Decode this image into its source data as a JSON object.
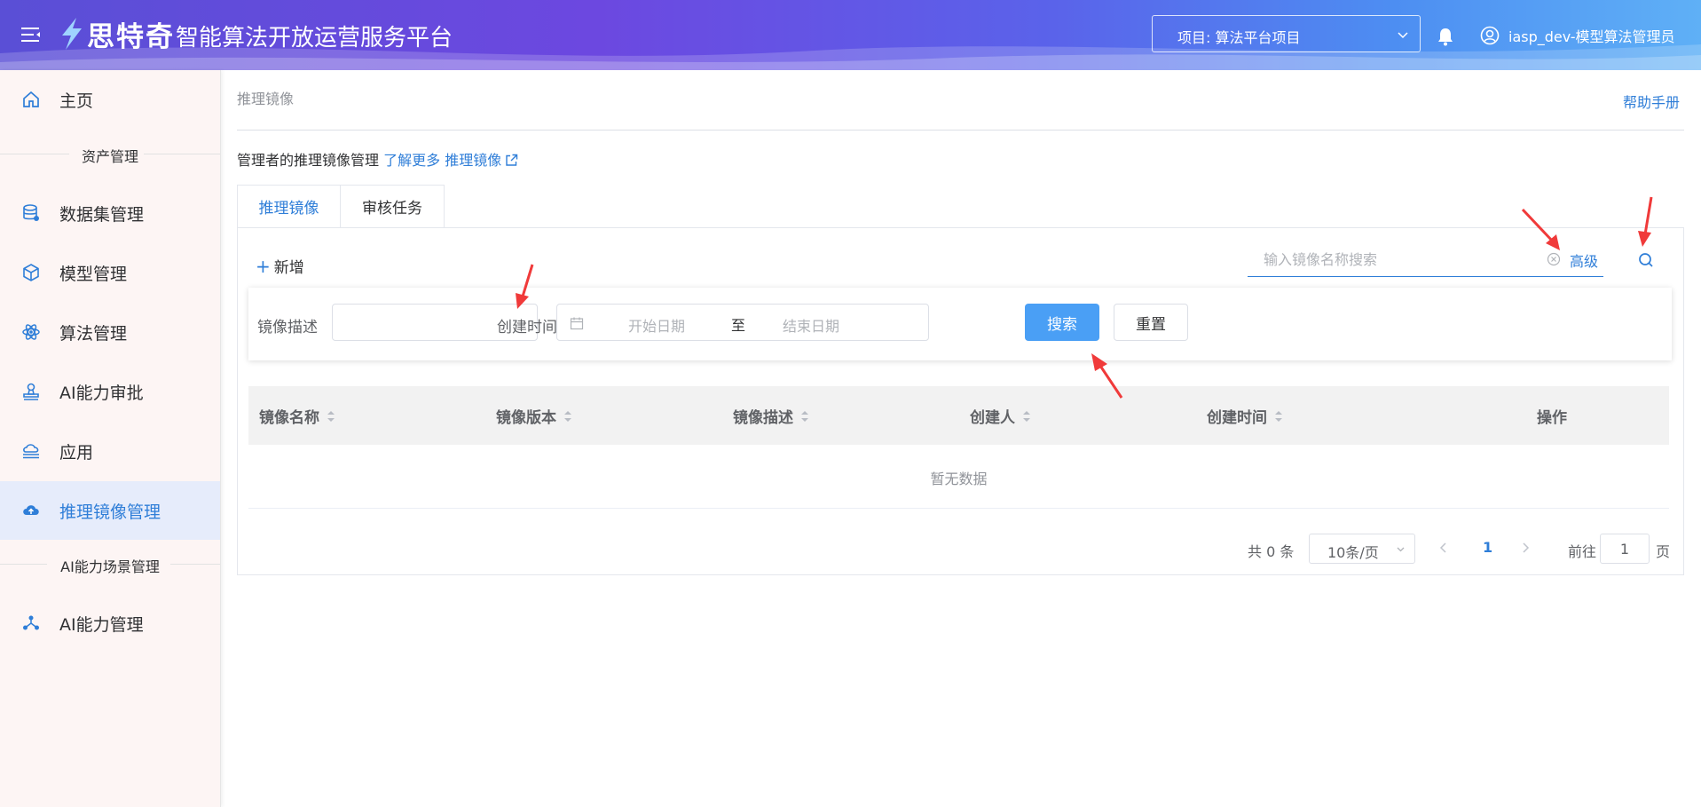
{
  "header": {
    "logo_text": "思特奇",
    "app_title": "智能算法开放运营服务平台",
    "project_label": "项目: 算法平台项目",
    "user_name": "iasp_dev-模型算法管理员"
  },
  "sidebar": {
    "home": "主页",
    "section_assets": "资产管理",
    "items": [
      {
        "label": "数据集管理",
        "icon": "database-icon"
      },
      {
        "label": "模型管理",
        "icon": "cube-icon"
      },
      {
        "label": "算法管理",
        "icon": "atom-icon"
      },
      {
        "label": "AI能力审批",
        "icon": "stamp-icon"
      },
      {
        "label": "应用",
        "icon": "cloud-stack-icon"
      },
      {
        "label": "推理镜像管理",
        "icon": "cloud-upload-icon",
        "active": true
      }
    ],
    "section_scene": "AI能力场景管理",
    "ai_manage": "AI能力管理"
  },
  "main": {
    "breadcrumb": "推理镜像",
    "help_link": "帮助手册",
    "desc_prefix": "管理者的推理镜像管理",
    "desc_link": "了解更多 推理镜像",
    "tabs": [
      "推理镜像",
      "审核任务"
    ],
    "add_label": "新增",
    "search_placeholder": "输入镜像名称搜索",
    "advanced_label": "高级",
    "filter": {
      "desc_label": "镜像描述",
      "time_label": "创建时间",
      "start_placeholder": "开始日期",
      "range_sep": "至",
      "end_placeholder": "结束日期",
      "search_btn": "搜索",
      "reset_btn": "重置"
    },
    "table": {
      "columns": [
        "镜像名称",
        "镜像版本",
        "镜像描述",
        "创建人",
        "创建时间",
        "操作"
      ],
      "empty_text": "暂无数据"
    },
    "pagination": {
      "total": "共 0 条",
      "page_size": "10条/页",
      "current_page": "1",
      "goto_label": "前往",
      "goto_value": "1",
      "page_unit": "页"
    }
  },
  "colors": {
    "accent": "#2f7ed8",
    "search_button": "#4a9ff5",
    "annotation_arrow": "#f03a3a"
  }
}
